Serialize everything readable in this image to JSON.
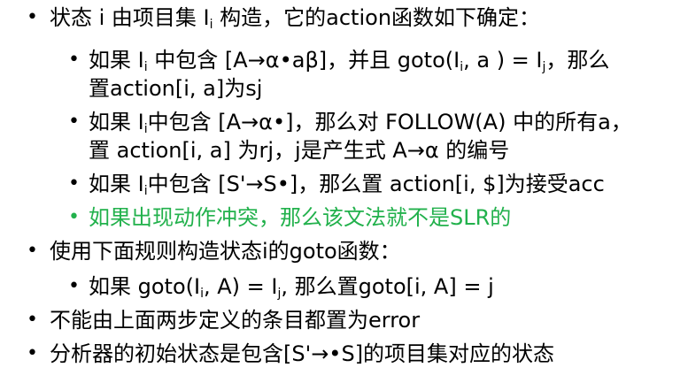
{
  "bullets": {
    "main": "•",
    "sub": "–"
  },
  "items": {
    "state_intro": "状态 i 由项目集 I",
    "state_intro_sub": "i",
    "state_intro_rest": " 构造，它的action函数如下确定：",
    "rule1_a": "如果 I",
    "rule1_sub_i": "i",
    "rule1_b": " 中包含 [A→α•aβ]，并且 goto(I",
    "rule1_sub_i2": "i",
    "rule1_c": ", a ) = I",
    "rule1_sub_j": "j",
    "rule1_d": "，那么",
    "rule1_cont": "置action[i, a]为sj",
    "rule2_a": "如果 I",
    "rule2_sub_i": "i",
    "rule2_b": "中包含 [A→α•]，那么对 FOLLOW(A) 中的所有a，",
    "rule2_cont": "置 action[i, a] 为rj，j是产生式 A→α 的编号",
    "rule3_a": "如果 I",
    "rule3_sub_i": "i",
    "rule3_b": "中包含 [S'→S•]，那么置 action[i, $]为接受acc",
    "rule4": "如果出现动作冲突，那么该文法就不是SLR的",
    "goto_intro": "使用下面规则构造状态i的goto函数：",
    "goto_rule_a": "如果 goto(I",
    "goto_rule_sub_i": "i",
    "goto_rule_b": ", A) = I",
    "goto_rule_sub_j": "j",
    "goto_rule_c": ", 那么置goto[i, A] = j",
    "error_rule": "不能由上面两步定义的条目都置为error",
    "initial_state": "分析器的初始状态是包含[S'→•S]的项目集对应的状态"
  },
  "colors": {
    "text": "#000000",
    "highlight": "#22b14c"
  }
}
